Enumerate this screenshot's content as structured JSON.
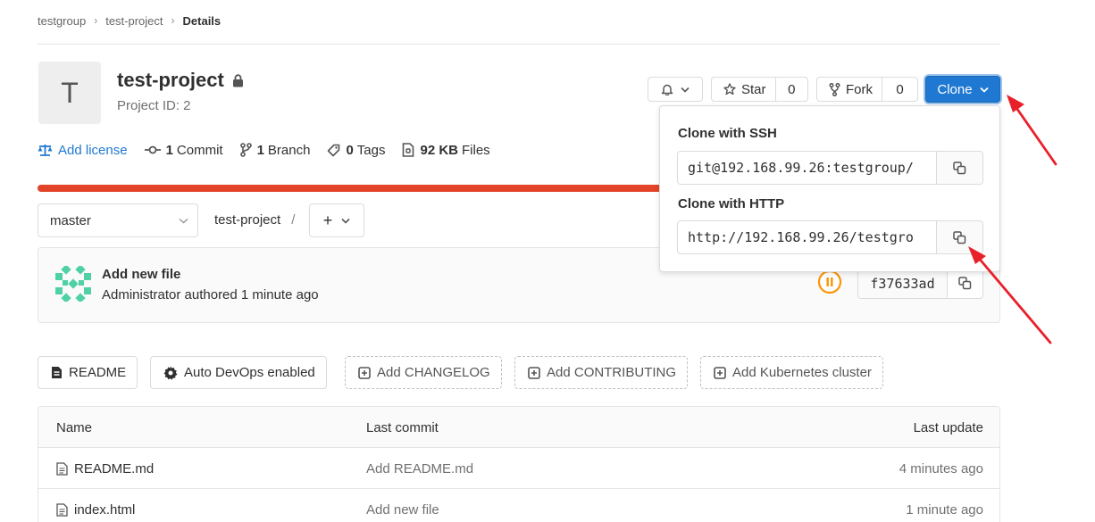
{
  "breadcrumb": {
    "group": "testgroup",
    "project": "test-project",
    "current": "Details"
  },
  "project": {
    "avatar_letter": "T",
    "name": "test-project",
    "id_text": "Project ID: 2"
  },
  "stats": {
    "license": "Add license",
    "commits_count": "1",
    "commits_label": "Commit",
    "branches_count": "1",
    "branches_label": "Branch",
    "tags_count": "0",
    "tags_label": "Tags",
    "files_size": "92 KB",
    "files_label": "Files"
  },
  "actions": {
    "star_label": "Star",
    "star_count": "0",
    "fork_label": "Fork",
    "fork_count": "0",
    "clone_label": "Clone"
  },
  "clone_dropdown": {
    "ssh_label": "Clone with SSH",
    "ssh_url": "git@192.168.99.26:testgroup/",
    "http_label": "Clone with HTTP",
    "http_url": "http://192.168.99.26/testgro"
  },
  "branch": {
    "selected": "master",
    "path": "test-project",
    "slash": "/",
    "add_symbol": "+"
  },
  "commit": {
    "title": "Add new file",
    "meta": "Administrator authored 1 minute ago",
    "sha": "f37633ad"
  },
  "quick_actions": {
    "readme": "README",
    "autodevops": "Auto DevOps enabled",
    "changelog": "Add CHANGELOG",
    "contributing": "Add CONTRIBUTING",
    "kubernetes": "Add Kubernetes cluster"
  },
  "files": {
    "headers": {
      "name": "Name",
      "last_commit": "Last commit",
      "last_update": "Last update"
    },
    "rows": [
      {
        "name": "README.md",
        "last_commit": "Add README.md",
        "last_update": "4 minutes ago"
      },
      {
        "name": "index.html",
        "last_commit": "Add new file",
        "last_update": "1 minute ago"
      }
    ]
  },
  "colors": {
    "accent": "#1f78d1",
    "language_bar": "#e24329",
    "pipeline": "#fc9403",
    "annotation_arrow": "#e8202a"
  }
}
